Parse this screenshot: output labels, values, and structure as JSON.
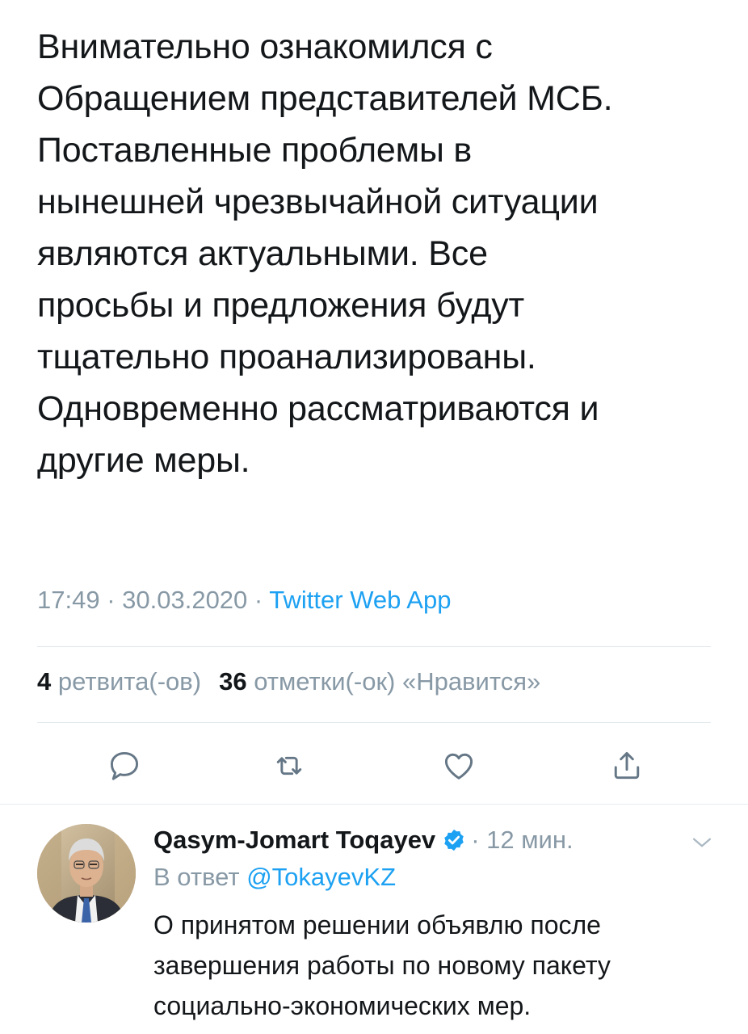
{
  "tweet": {
    "text": "Внимательно ознакомился с\nОбращением представителей МСБ.\nПоставленные проблемы в\nнынешней чрезвычайной ситуации\nявляются актуальными. Все\nпросьбы и предложения будут\nтщательно проанализированы.\nОдновременно рассматриваются и\nдругие меры.",
    "time": "17:49",
    "date": "30.03.2020",
    "sep": " · ",
    "source": "Twitter Web App",
    "retweets_count": "4",
    "retweets_label": "ретвита(-ов)",
    "likes_count": "36",
    "likes_label": "отметки(-ок) «Нравится»"
  },
  "actions": {
    "reply_icon": "reply-icon",
    "retweet_icon": "retweet-icon",
    "like_icon": "heart-icon",
    "share_icon": "share-icon"
  },
  "reply": {
    "name": "Qasym-Jomart Toqayev",
    "time": "· 12 мин.",
    "reply_prefix": "В ответ ",
    "reply_handle": "@TokayevKZ",
    "text": "О принятом решении объявлю после\nзавершения работы по новому пакету\nсоциально-экономических мер."
  },
  "colors": {
    "accent": "#1da1f2",
    "muted": "#8899a6",
    "text": "#14171a"
  }
}
